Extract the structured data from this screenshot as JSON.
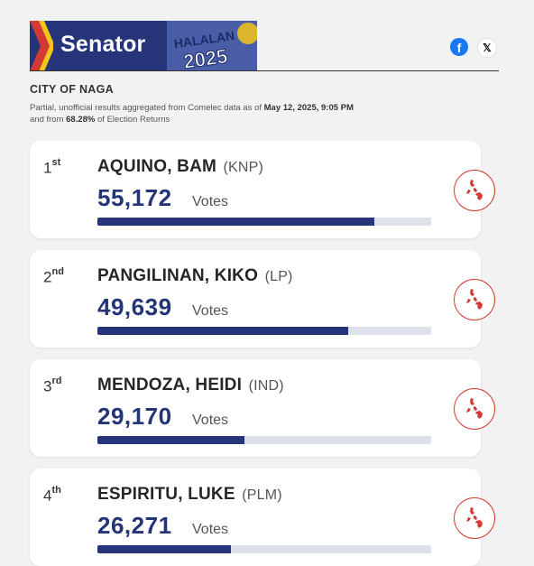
{
  "header": {
    "title": "Senator",
    "logo_text_top": "HALALAN",
    "logo_text_bottom": "2025",
    "facebook_icon_glyph": "f",
    "x_icon_glyph": "𝕏"
  },
  "location": "CITY OF NAGA",
  "note": {
    "prefix": "Partial, unofficial results aggregated from Comelec data as of",
    "timestamp": "May 12, 2025, 9:05 PM",
    "middle": "and from",
    "percent": "68.28%",
    "suffix": "of Election Returns"
  },
  "votes_label": "Votes",
  "candidates": [
    {
      "rank": "1",
      "rank_suffix": "st",
      "name": "AQUINO, BAM",
      "party": "(KNP)",
      "votes": "55,172",
      "progress": 0.83
    },
    {
      "rank": "2",
      "rank_suffix": "nd",
      "name": "PANGILINAN, KIKO",
      "party": "(LP)",
      "votes": "49,639",
      "progress": 0.75
    },
    {
      "rank": "3",
      "rank_suffix": "rd",
      "name": "MENDOZA, HEIDI",
      "party": "(IND)",
      "votes": "29,170",
      "progress": 0.44
    },
    {
      "rank": "4",
      "rank_suffix": "th",
      "name": "ESPIRITU, LUKE",
      "party": "(PLM)",
      "votes": "26,271",
      "progress": 0.4
    }
  ],
  "colors": {
    "brand": "#26347a",
    "accent": "#d23a33",
    "bar_bg": "#dde2ea"
  },
  "icons": {
    "map_button": "philippines-map-icon"
  }
}
